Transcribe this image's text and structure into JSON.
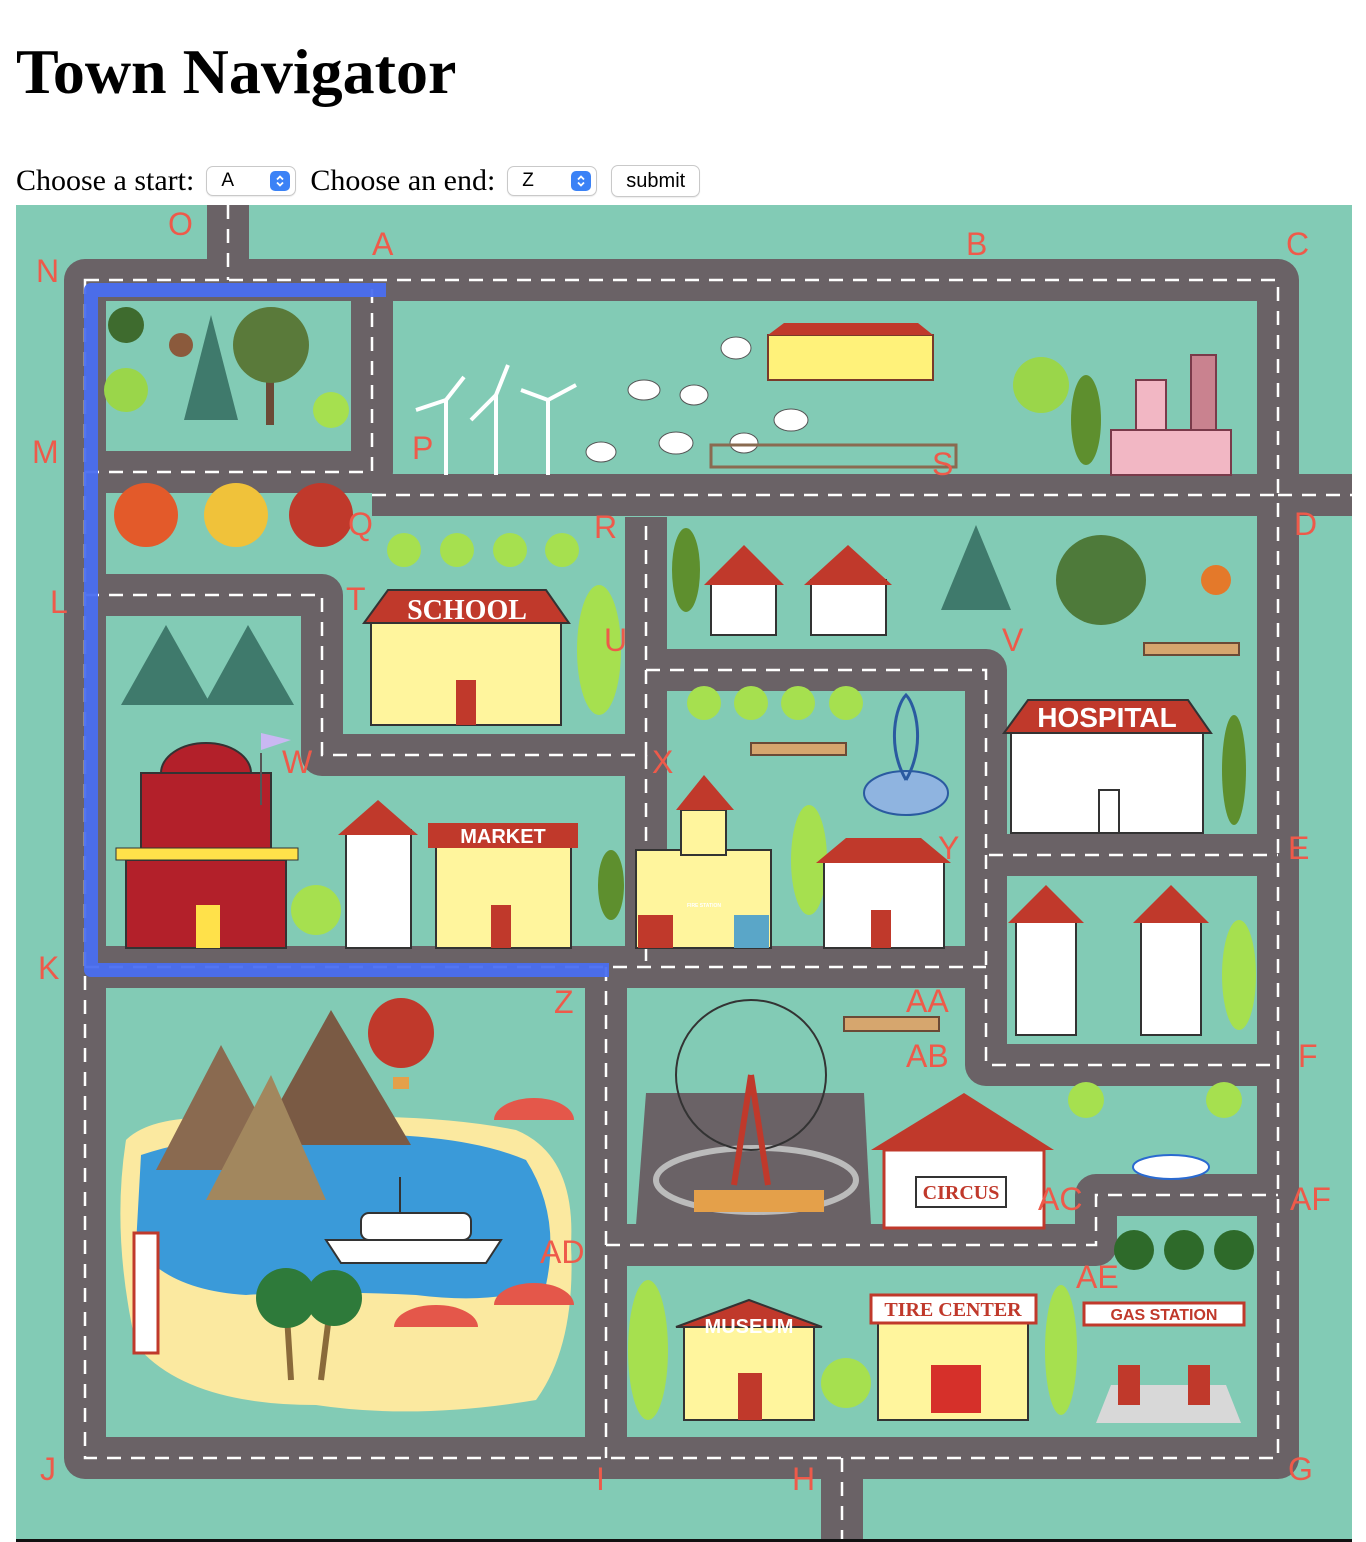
{
  "page": {
    "title": "Town Navigator"
  },
  "controls": {
    "start_label": "Choose a start:",
    "start_value": "A",
    "end_label": "Choose an end:",
    "end_value": "Z",
    "submit_label": "submit"
  },
  "map": {
    "colors": {
      "grass": "#82cbb5",
      "road": "#6a6266",
      "lane": "#ffffff",
      "route": "#4a6ef0",
      "label": "#ee5a4a"
    },
    "node_labels": [
      "O",
      "A",
      "B",
      "C",
      "N",
      "M",
      "P",
      "S",
      "D",
      "R",
      "Q",
      "L",
      "T",
      "U",
      "V",
      "W",
      "X",
      "Y",
      "E",
      "K",
      "Z",
      "AA",
      "AB",
      "F",
      "AC",
      "AF",
      "AD",
      "AE",
      "J",
      "I",
      "H",
      "G"
    ],
    "building_signs": {
      "school": "SCHOOL",
      "hospital": "HOSPITAL",
      "market": "MARKET",
      "fire_station": "FIRE STATION",
      "circus": "CIRCUS",
      "museum": "MUSEUM",
      "tire_center": "TIRE CENTER",
      "gas_station": "GAS STATION"
    }
  }
}
